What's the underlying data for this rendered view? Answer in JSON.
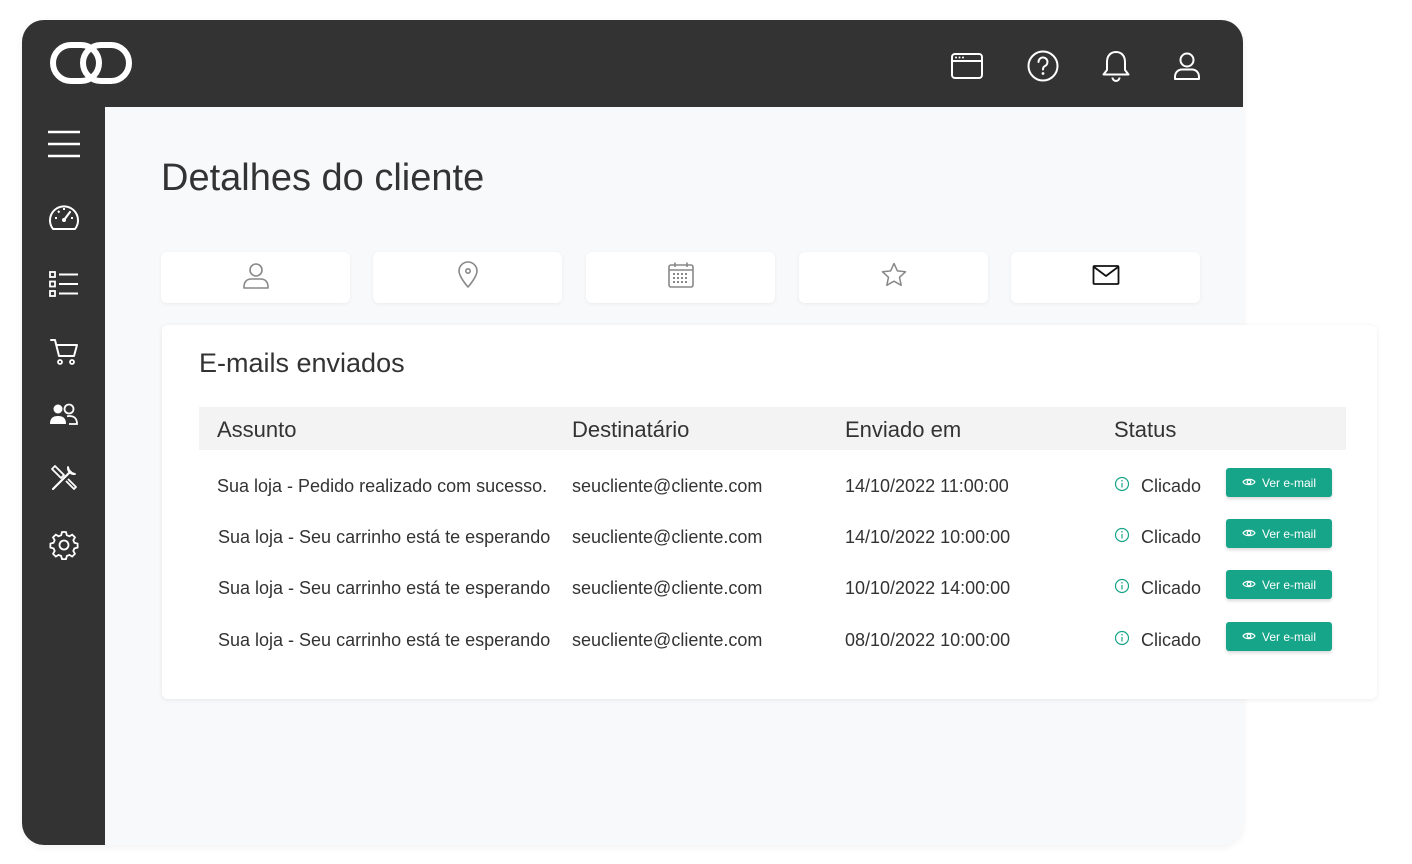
{
  "header": {
    "logo_icon": "link-logo-icon",
    "icons": [
      "browser-window-icon",
      "help-circle-icon",
      "bell-icon",
      "user-icon"
    ]
  },
  "sidebar": {
    "items": [
      {
        "icon": "menu-icon"
      },
      {
        "icon": "dashboard-gauge-icon"
      },
      {
        "icon": "list-icon"
      },
      {
        "icon": "cart-icon"
      },
      {
        "icon": "users-icon"
      },
      {
        "icon": "tools-icon"
      },
      {
        "icon": "gear-icon"
      }
    ]
  },
  "page": {
    "title": "Detalhes do cliente"
  },
  "tabs": [
    {
      "icon": "user-icon",
      "active": false
    },
    {
      "icon": "location-pin-icon",
      "active": false
    },
    {
      "icon": "calendar-icon",
      "active": false
    },
    {
      "icon": "star-icon",
      "active": false
    },
    {
      "icon": "mail-icon",
      "active": true
    }
  ],
  "emails": {
    "title": "E-mails enviados",
    "columns": [
      "Assunto",
      "Destinatário",
      "Enviado em",
      "Status"
    ],
    "button_label": "Ver e-mail",
    "rows": [
      {
        "subject": "Sua loja - Pedido realizado com sucesso.",
        "recipient": "seucliente@cliente.com",
        "sent_at": "14/10/2022 11:00:00",
        "status": "Clicado"
      },
      {
        "subject": "Sua loja - Seu carrinho está te esperando",
        "recipient": "seucliente@cliente.com",
        "sent_at": "14/10/2022 10:00:00",
        "status": "Clicado"
      },
      {
        "subject": "Sua loja - Seu carrinho está te esperando",
        "recipient": "seucliente@cliente.com",
        "sent_at": "10/10/2022 14:00:00",
        "status": "Clicado"
      },
      {
        "subject": "Sua loja - Seu carrinho está te esperando",
        "recipient": "seucliente@cliente.com",
        "sent_at": "08/10/2022 10:00:00",
        "status": "Clicado"
      }
    ]
  },
  "colors": {
    "sidebar": "#333333",
    "background": "#f8f9fb",
    "accent": "#17a589"
  }
}
